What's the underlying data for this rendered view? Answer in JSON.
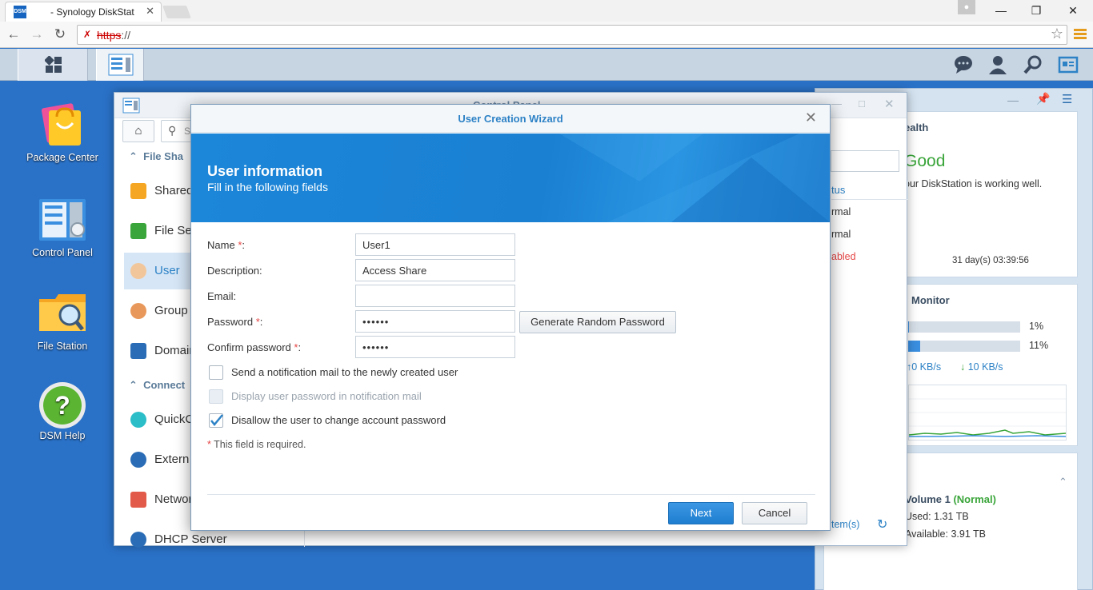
{
  "browser": {
    "tab_title": "- Synology DiskStat",
    "tab_favicon": "DSM",
    "url_prefix": "https",
    "url_rest": "://",
    "minimize": "—",
    "restore": "❐",
    "close": "✕"
  },
  "desktop": {
    "icons": [
      {
        "label": "Package Center"
      },
      {
        "label": "Control Panel"
      },
      {
        "label": "File Station"
      },
      {
        "label": "DSM Help"
      }
    ]
  },
  "control_panel": {
    "title": "Control Panel",
    "search_placeholder": "Search",
    "section_file": "File Sha",
    "section_connect": "Connect",
    "items": [
      {
        "label": "Shared"
      },
      {
        "label": "File Se"
      },
      {
        "label": "User"
      },
      {
        "label": "Group"
      },
      {
        "label": "Domain"
      },
      {
        "label": "QuickC"
      },
      {
        "label": "Extern"
      },
      {
        "label": "Networ"
      },
      {
        "label": "DHCP Server"
      }
    ],
    "status_col": "tus",
    "rows": [
      "rmal",
      "rmal",
      "abled"
    ],
    "footer_items": "tem(s)"
  },
  "widget": {
    "health_title": "ealth",
    "health_status": "Good",
    "health_text": "our DiskStation is working well.",
    "uptime": "31 day(s) 03:39:56",
    "monitor_title": "Monitor",
    "cpu": "1%",
    "ram": "11%",
    "cpu_level": 0.01,
    "ram_level": 0.11,
    "upload": "0 KB/s",
    "download": "10 KB/s",
    "volume_title": "Volume 1",
    "volume_status": "(Normal)",
    "used": "Used: 1.31 TB",
    "available": "Available: 3.91 TB"
  },
  "wizard": {
    "title": "User Creation Wizard",
    "heading": "User information",
    "subheading": "Fill in the following fields",
    "fields": {
      "name_label": "Name",
      "name_value": "User1",
      "description_label": "Description:",
      "description_value": "Access Share",
      "email_label": "Email:",
      "email_value": "",
      "password_label": "Password",
      "password_value": "••••••",
      "confirm_label": "Confirm password",
      "confirm_value": "••••••"
    },
    "required_mark": "*",
    "colon": ":",
    "generate_button": "Generate Random Password",
    "checkboxes": [
      {
        "label": "Send a notification mail to the newly created user",
        "checked": false,
        "disabled": false
      },
      {
        "label": "Display user password in notification mail",
        "checked": false,
        "disabled": true
      },
      {
        "label": "Disallow the user to change account password",
        "checked": true,
        "disabled": false
      }
    ],
    "required_note": "This field is required.",
    "next_button": "Next",
    "cancel_button": "Cancel"
  },
  "colors": {
    "accent": "#2d82c6",
    "good": "#3aa53a",
    "required": "#e64545",
    "banner": "#1c86d8"
  }
}
